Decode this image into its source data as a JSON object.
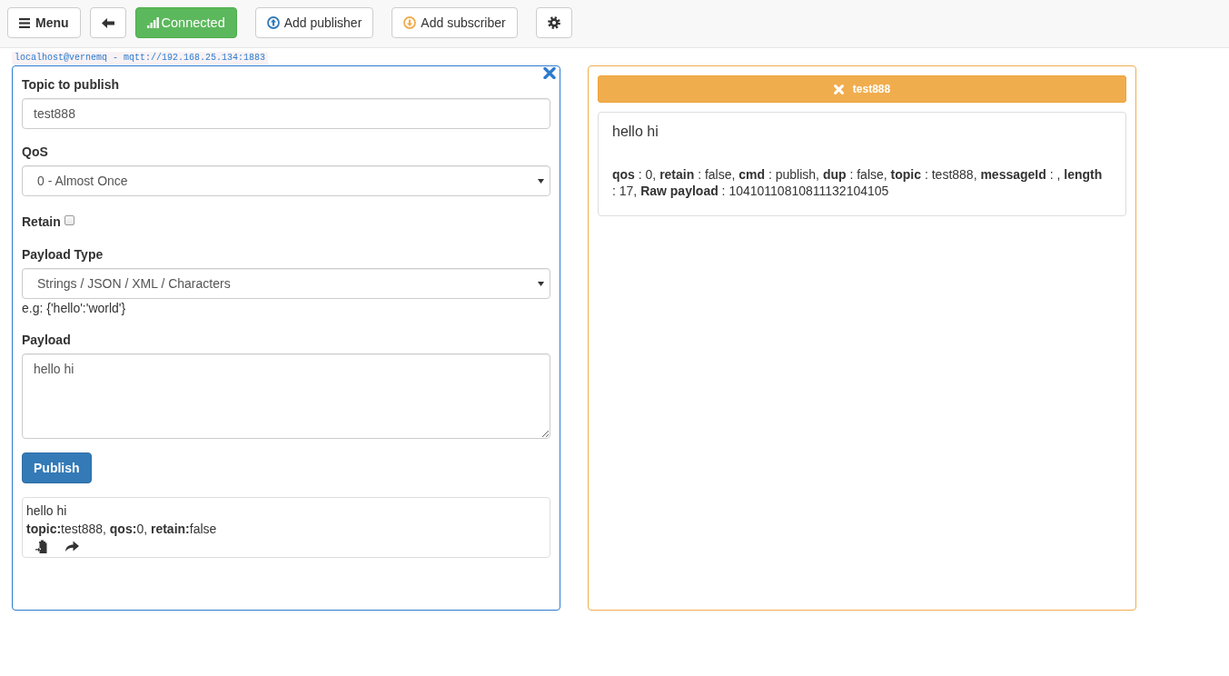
{
  "toolbar": {
    "buttons": [
      {
        "kind": "menu",
        "label": "Menu"
      },
      {
        "kind": "back"
      },
      {
        "kind": "status",
        "label": "Connected"
      },
      {
        "kind": "add_publisher",
        "label": "Add publisher"
      },
      {
        "kind": "add_subscriber",
        "label": "Add subscriber"
      },
      {
        "kind": "settings"
      }
    ]
  },
  "connection_label": "localhost@vernemq - mqtt://192.168.25.134:1883",
  "publisher": {
    "topic_label": "Topic to publish",
    "topic": "test888",
    "qos_label": "QoS",
    "qos": "0 - Almost Once",
    "retain_label": "Retain",
    "retain": false,
    "payload_type_label": "Payload Type",
    "payload_type": "Strings / JSON / XML / Characters",
    "payload_type_hint": "e.g: {'hello':'world'}",
    "payload_label": "Payload",
    "payload": "hello hi",
    "publish_button": "Publish",
    "history": [
      {
        "payload": "hello hi",
        "meta": "**topic:**test888, **qos:**0, **retain:**false"
      }
    ]
  },
  "subscriber": {
    "topic": "test888",
    "messages": [
      {
        "payload": "hello hi",
        "details": "**qos** : 0, **retain** : false, **cmd** : publish, **dup** : false, **topic** : test888, **messageId** : , **length** : 17, **Raw payload** : 10410110810811132104105"
      }
    ]
  }
}
